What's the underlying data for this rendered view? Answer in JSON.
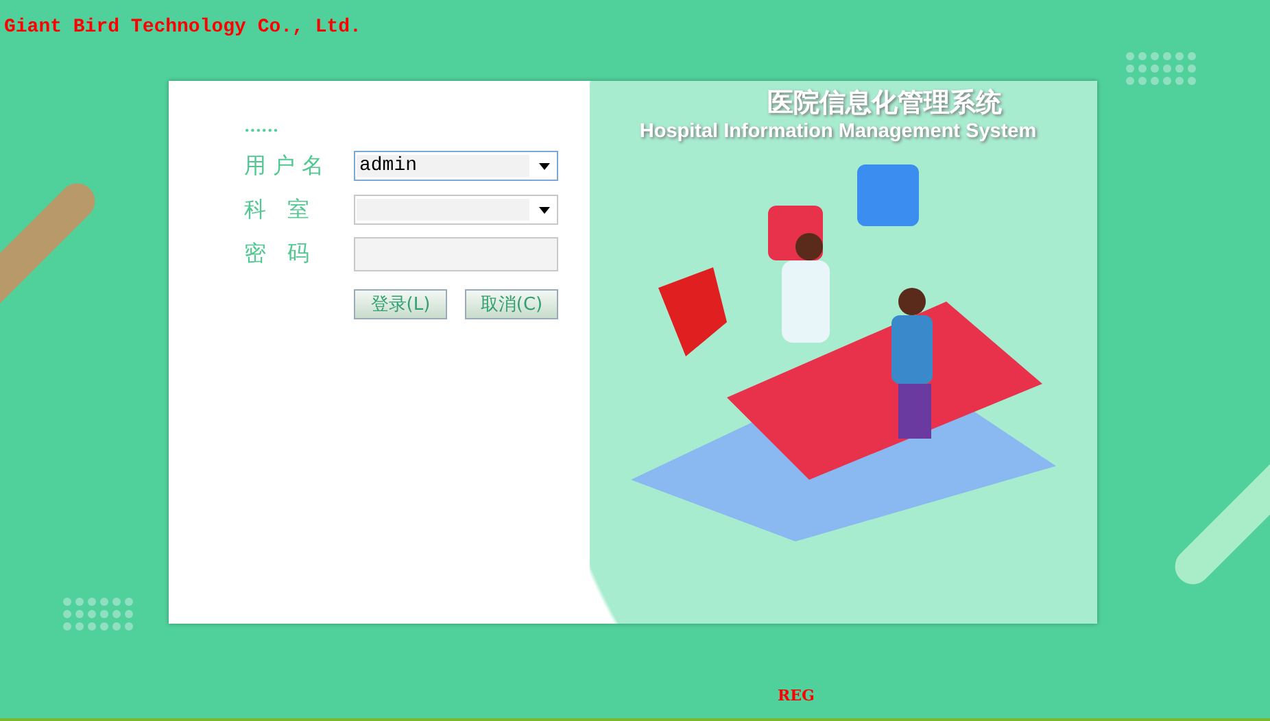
{
  "company": "Giant Bird Technology Co., Ltd.",
  "form": {
    "heading": "......",
    "fields": [
      {
        "kind": "combo",
        "label": "用 户 名",
        "value": "admin"
      },
      {
        "kind": "combo",
        "label": "科   室"
      },
      {
        "kind": "password",
        "label": "密   码"
      }
    ],
    "buttons": [
      "登录(L)",
      "取消(C)"
    ]
  },
  "banner": {
    "title": "医院信息化管理系统",
    "subtitle": "Hospital Information Management System"
  },
  "footer": "REG"
}
